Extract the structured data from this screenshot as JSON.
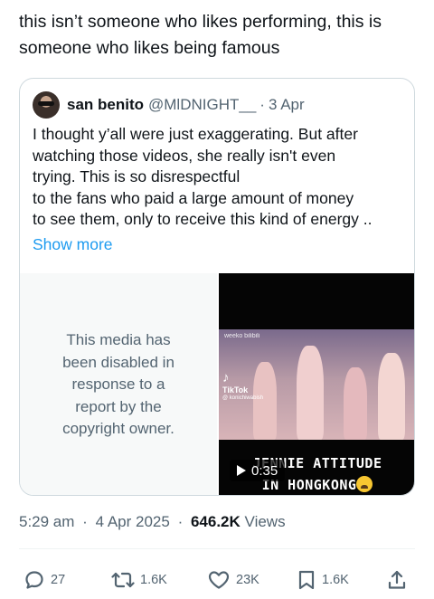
{
  "tweet": {
    "text": "this isn’t someone who likes performing, this is someone who likes being famous"
  },
  "quote": {
    "name": "san benito",
    "handle": "@MlDNIGHT__",
    "dot": "·",
    "date": "3 Apr",
    "lines": [
      "I thought y’all were just exaggerating. But after",
      "watching those videos, she really isn't even",
      "trying. This is so disrespectful",
      "to the fans who paid a large amount of money",
      "to see them, only to receive this kind of energy .."
    ],
    "show_more": "Show more"
  },
  "media": {
    "disabled_text": "This media has been disabled in response to a report by the copyright owner.",
    "video": {
      "stage_logo": "weeko bilibili",
      "tiktok_label": "TikTok",
      "tiktok_handle": "@ konichiwabish",
      "caption_line1": "JENNIE ATTITUDE",
      "caption_line2": "IN HONGKONG",
      "duration": "0:35"
    }
  },
  "meta": {
    "time": "5:29 am",
    "date": "4 Apr 2025",
    "views_count": "646.2K",
    "views_label": "Views",
    "separator": "·"
  },
  "actions": {
    "replies": "27",
    "reposts": "1.6K",
    "likes": "23K",
    "bookmarks": "1.6K"
  },
  "colors": {
    "text": "#0f1419",
    "secondary": "#536471",
    "link": "#1d9bf0",
    "border": "#cfd9de"
  }
}
